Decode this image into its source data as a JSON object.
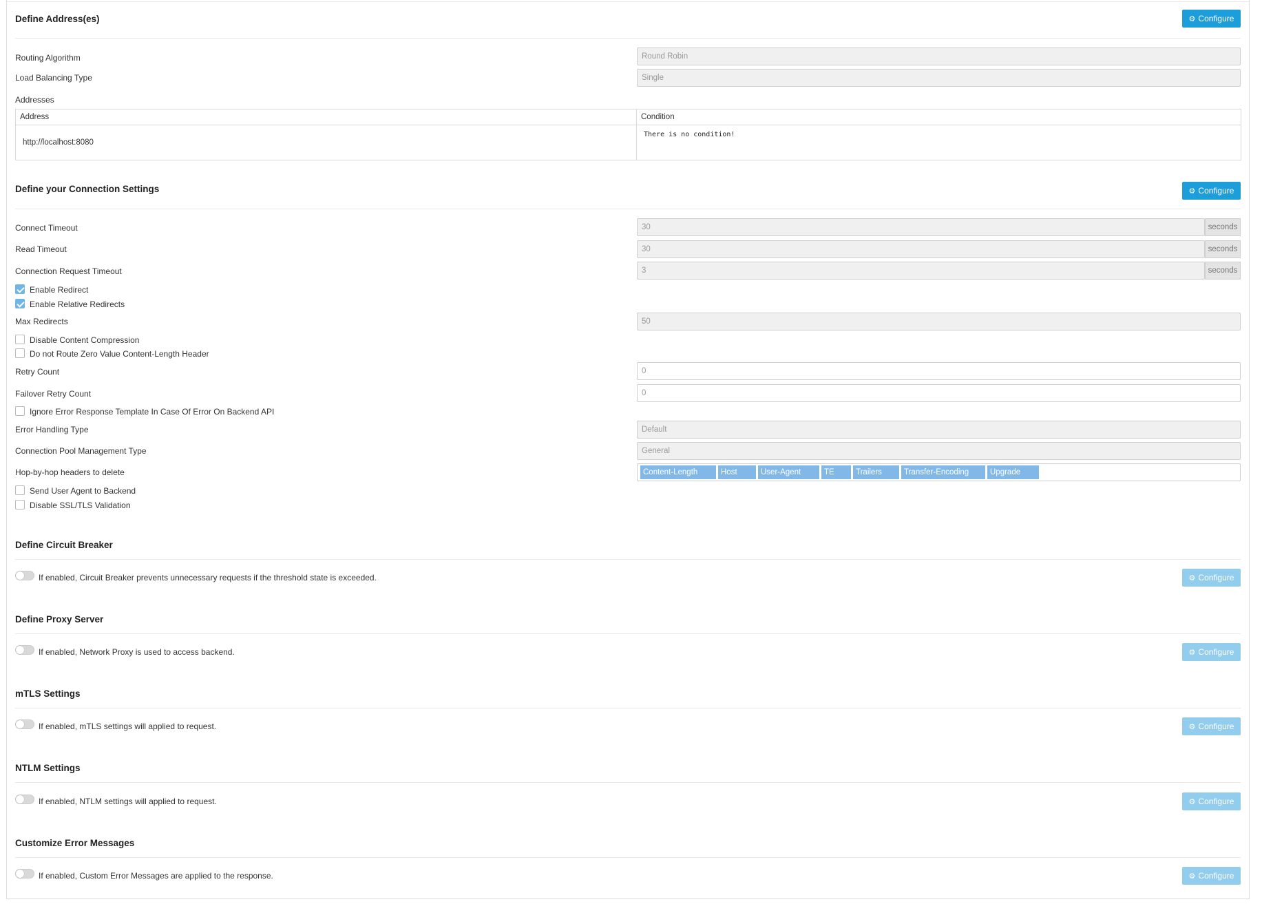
{
  "address_section": {
    "title": "Define Address(es)",
    "configure_label": "Configure",
    "routing_algorithm_label": "Routing Algorithm",
    "routing_algorithm_value": "Round Robin",
    "load_balancing_label": "Load Balancing Type",
    "load_balancing_value": "Single",
    "addresses_label": "Addresses",
    "table": {
      "headers": [
        "Address",
        "Condition"
      ],
      "rows": [
        {
          "address": "http://localhost:8080",
          "condition": "There is no condition!"
        }
      ]
    }
  },
  "connection_section": {
    "title": "Define your Connection Settings",
    "configure_label": "Configure",
    "connect_timeout": {
      "label": "Connect Timeout",
      "value": "30",
      "unit": "seconds"
    },
    "read_timeout": {
      "label": "Read Timeout",
      "value": "30",
      "unit": "seconds"
    },
    "connection_request_timeout": {
      "label": "Connection Request Timeout",
      "value": "3",
      "unit": "seconds"
    },
    "enable_redirect": {
      "label": "Enable Redirect",
      "checked": true
    },
    "enable_relative_redirects": {
      "label": "Enable Relative Redirects",
      "checked": true
    },
    "max_redirects": {
      "label": "Max Redirects",
      "value": "50"
    },
    "disable_content_compression": {
      "label": "Disable Content Compression",
      "checked": false
    },
    "no_route_zero_content_length": {
      "label": "Do not Route Zero Value Content-Length Header",
      "checked": false
    },
    "retry_count": {
      "label": "Retry Count",
      "value": "0"
    },
    "failover_retry_count": {
      "label": "Failover Retry Count",
      "value": "0"
    },
    "ignore_error_template": {
      "label": "Ignore Error Response Template In Case Of Error On Backend API",
      "checked": false
    },
    "error_handling_type": {
      "label": "Error Handling Type",
      "value": "Default"
    },
    "connection_pool_type": {
      "label": "Connection Pool Management Type",
      "value": "General"
    },
    "hop_headers": {
      "label": "Hop-by-hop headers to delete",
      "tags": [
        "Content-Length",
        "Host",
        "User-Agent",
        "TE",
        "Trailers",
        "Transfer-Encoding",
        "Upgrade"
      ]
    },
    "send_user_agent": {
      "label": "Send User Agent to Backend",
      "checked": false
    },
    "disable_ssl_validation": {
      "label": "Disable SSL/TLS Validation",
      "checked": false
    }
  },
  "toggle_sections": [
    {
      "title": "Define Circuit Breaker",
      "description": "If enabled, Circuit Breaker prevents unnecessary requests if the threshold state is exceeded.",
      "configure_label": "Configure",
      "enabled": false
    },
    {
      "title": "Define Proxy Server",
      "description": "If enabled, Network Proxy is used to access backend.",
      "configure_label": "Configure",
      "enabled": false
    },
    {
      "title": "mTLS Settings",
      "description": "If enabled, mTLS settings will applied to request.",
      "configure_label": "Configure",
      "enabled": false
    },
    {
      "title": "NTLM Settings",
      "description": "If enabled, NTLM settings will applied to request.",
      "configure_label": "Configure",
      "enabled": false
    },
    {
      "title": "Customize Error Messages",
      "description": "If enabled, Custom Error Messages are applied to the response.",
      "configure_label": "Configure",
      "enabled": false
    }
  ],
  "colors": {
    "primary_button": "#1e9ddb",
    "disabled_button": "#93cdee",
    "checkbox_checked": "#6fb6e6",
    "tag": "#82b8e8"
  },
  "icons": {
    "configure_button": "gear-icon"
  }
}
